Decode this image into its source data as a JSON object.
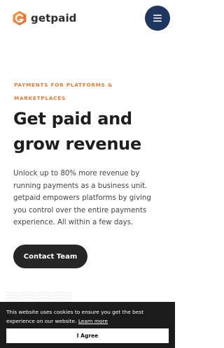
{
  "brand": {
    "name": "getpaid",
    "logo_icon": "getpaid-g-icon",
    "accent_color": "#e07b39",
    "navy_color": "#1f3760"
  },
  "header": {
    "menu_icon": "hamburger-menu-icon"
  },
  "hero": {
    "eyebrow": "PAYMENTS FOR PLATFORMS & MARKETPLACES",
    "title": "Get paid and grow revenue",
    "body": "Unlock up to 80% more revenue by running payments as a business unit. getpaid empowers platforms by giving you control over the entire payments experience. All within a few days.",
    "cta_label": "Contact Team"
  },
  "cookie_banner": {
    "text": "This website uses cookies to ensure you get the best experience on our website.",
    "link_label": "Learn more",
    "accept_label": "I Agree"
  }
}
